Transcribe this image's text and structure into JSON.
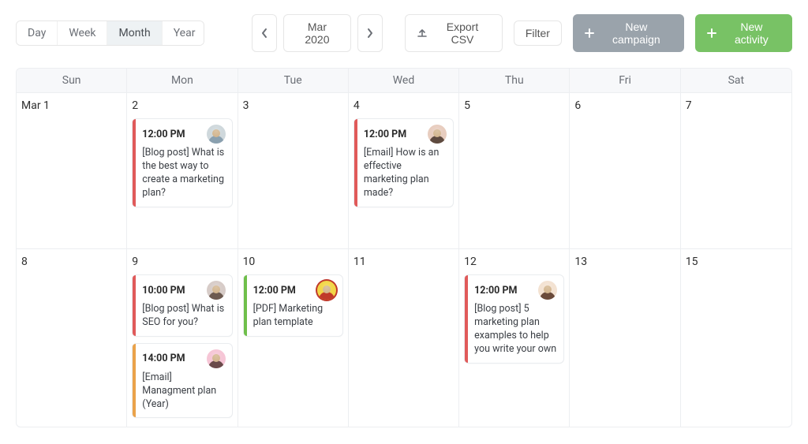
{
  "viewTabs": {
    "day": "Day",
    "week": "Week",
    "month": "Month",
    "year": "Year",
    "active": "month"
  },
  "nav": {
    "current_label": "Mar 2020"
  },
  "actions": {
    "export_label": "Export CSV",
    "filter_label": "Filter",
    "new_campaign_label": "New campaign",
    "new_activity_label": "New activity"
  },
  "weekdays": [
    "Sun",
    "Mon",
    "Tue",
    "Wed",
    "Thu",
    "Fri",
    "Sat"
  ],
  "stripeColors": {
    "red": "#e05a5a",
    "green": "#6fbf4a",
    "orange": "#eaa24a"
  },
  "rows": [
    {
      "cells": [
        {
          "label": "Mar 1",
          "events": []
        },
        {
          "label": "2",
          "events": [
            {
              "time": "12:00 PM",
              "title": "[Blog post] What is the best way to create a marketing plan?",
              "stripe": "red",
              "avatar": {
                "bg": "#cfd8dc",
                "body": "#8aa0af",
                "ring": ""
              }
            }
          ]
        },
        {
          "label": "3",
          "events": []
        },
        {
          "label": "4",
          "events": [
            {
              "time": "12:00 PM",
              "title": "[Email] How is an effective marketing plan made?",
              "stripe": "red",
              "avatar": {
                "bg": "#e8cdbf",
                "body": "#5e4a3f",
                "ring": ""
              }
            }
          ]
        },
        {
          "label": "5",
          "events": []
        },
        {
          "label": "6",
          "events": []
        },
        {
          "label": "7",
          "events": []
        }
      ]
    },
    {
      "cells": [
        {
          "label": "8",
          "events": []
        },
        {
          "label": "9",
          "events": [
            {
              "time": "10:00 PM",
              "title": "[Blog post] What is SEO for you?",
              "stripe": "red",
              "avatar": {
                "bg": "#d7ccc8",
                "body": "#6d5a50",
                "ring": ""
              }
            },
            {
              "time": "14:00 PM",
              "title": "[Email] Managment plan (Year)",
              "stripe": "orange",
              "avatar": {
                "bg": "#f6c6d6",
                "body": "#6a4a4a",
                "ring": ""
              }
            }
          ]
        },
        {
          "label": "10",
          "events": [
            {
              "time": "12:00 PM",
              "title": "[PDF] Marketing plan template",
              "stripe": "green",
              "avatar": {
                "bg": "#f2d648",
                "body": "#c0392b",
                "ring": "#c0392b"
              }
            }
          ]
        },
        {
          "label": "11",
          "events": []
        },
        {
          "label": "12",
          "events": [
            {
              "time": "12:00 PM",
              "title": "[Blog post] 5 marketing plan examples to help you write your own",
              "stripe": "red",
              "avatar": {
                "bg": "#f3e2d2",
                "body": "#6a4a3a",
                "ring": ""
              }
            }
          ]
        },
        {
          "label": "13",
          "events": []
        },
        {
          "label": "15",
          "events": []
        }
      ]
    }
  ]
}
